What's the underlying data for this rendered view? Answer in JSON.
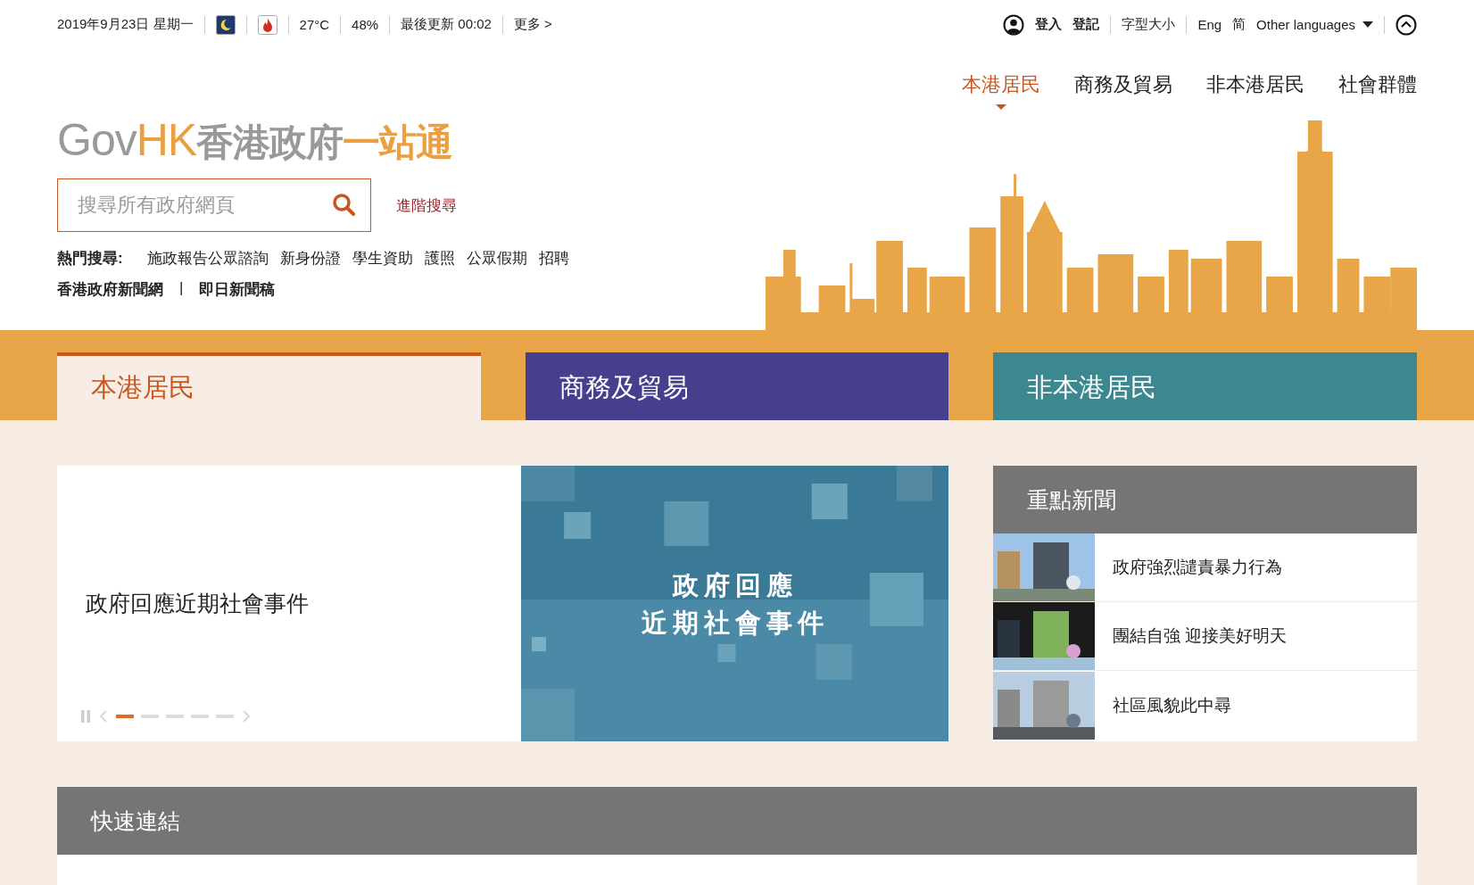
{
  "top_bar": {
    "date": "2019年9月23日 星期一",
    "temperature": "27°C",
    "humidity": "48%",
    "last_update": "最後更新 00:02",
    "more": "更多 >",
    "login": "登入",
    "register": "登記",
    "font_size": "字型大小",
    "languages": [
      "Eng",
      "简"
    ],
    "other_languages": "Other languages"
  },
  "main_nav": [
    {
      "label": "本港居民",
      "selected": true
    },
    {
      "label": "商務及貿易",
      "selected": false
    },
    {
      "label": "非本港居民",
      "selected": false
    },
    {
      "label": "社會群體",
      "selected": false
    }
  ],
  "logo": {
    "gov": "Gov",
    "hk": "HK",
    "name": "香港政府",
    "one_stop": "一站通"
  },
  "search": {
    "placeholder": "搜尋所有政府網頁",
    "advanced": "進階搜尋"
  },
  "hot_search": {
    "label": "熱門搜尋:",
    "items": [
      "施政報告公眾諮詢",
      "新身份證",
      "學生資助",
      "護照",
      "公眾假期",
      "招聘"
    ]
  },
  "news_links": {
    "items": [
      "香港政府新聞網",
      "即日新聞稿"
    ],
    "separator": "|"
  },
  "tabs": [
    {
      "label": "本港居民",
      "selected": true,
      "color": "#c8561f"
    },
    {
      "label": "商務及貿易",
      "selected": false,
      "color": "#453f8e"
    },
    {
      "label": "非本港居民",
      "selected": false,
      "color": "#3b8891"
    }
  ],
  "slider": {
    "caption": "政府回應近期社會事件",
    "image_text": [
      "政府回應",
      "近期社會事件"
    ],
    "slides": [
      {
        "selected": true
      },
      {
        "selected": false
      },
      {
        "selected": false
      },
      {
        "selected": false
      },
      {
        "selected": false
      }
    ]
  },
  "top_news": {
    "title": "重點新聞",
    "items": [
      {
        "title": "政府強烈譴責暴力行為"
      },
      {
        "title": "團結自強 迎接美好明天"
      },
      {
        "title": "社區風貌此中尋"
      }
    ]
  },
  "quick_links": {
    "title": "快速連結"
  }
}
